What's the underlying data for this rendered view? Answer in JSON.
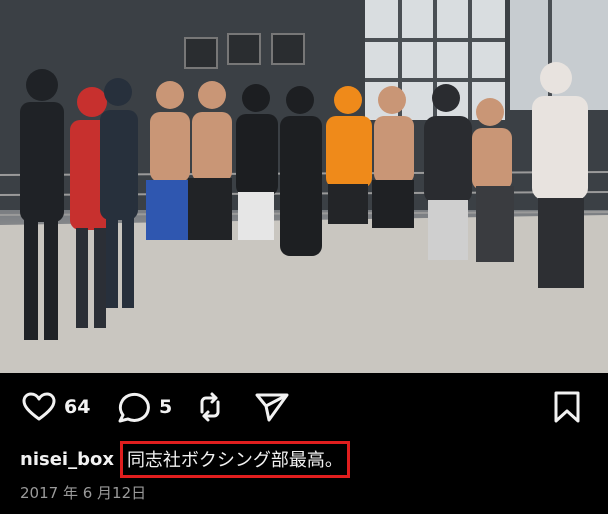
{
  "post": {
    "photo_alt": "",
    "likes": "64",
    "comments": "5",
    "username": "nisei_box",
    "caption": "同志社ボクシング部最高。",
    "date": "2017 年 6 月12日"
  },
  "icons": {
    "like": "heart-icon",
    "comment": "comment-bubble-icon",
    "repost": "repost-icon",
    "share": "send-icon",
    "save": "bookmark-icon"
  },
  "colors": {
    "background": "#000000",
    "highlight_border": "#e01e1e",
    "text": "#f2f2f2",
    "muted": "#9a9a9a"
  }
}
